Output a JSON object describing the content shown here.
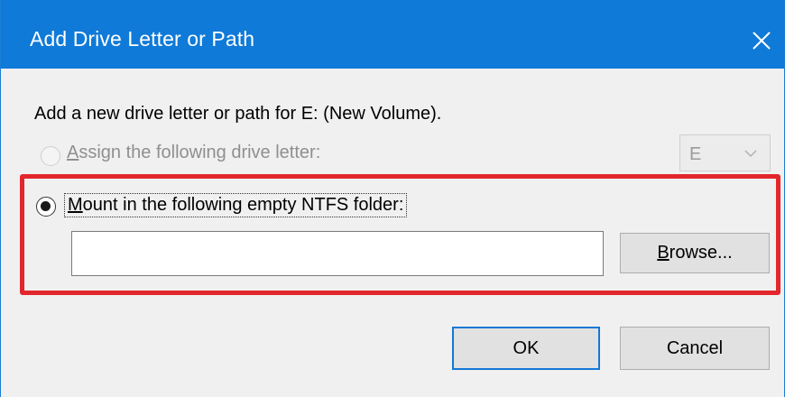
{
  "window": {
    "title": "Add Drive Letter or Path",
    "close_icon": "close-icon"
  },
  "description": "Add a new drive letter or path for E: (New Volume).",
  "assign_option": {
    "label_accel": "A",
    "label_rest": "ssign the following drive letter:",
    "selected": false,
    "enabled": false,
    "drive_letter": "E"
  },
  "mount_option": {
    "label_accel": "M",
    "label_rest": "ount in the following empty NTFS folder:",
    "selected": true,
    "enabled": true,
    "folder_path": ""
  },
  "buttons": {
    "browse_accel": "B",
    "browse_rest": "rowse...",
    "ok": "OK",
    "cancel": "Cancel"
  },
  "colors": {
    "titlebar": "#0f7ad8",
    "highlight": "#e2262c",
    "default_button_border": "#1378d6"
  }
}
